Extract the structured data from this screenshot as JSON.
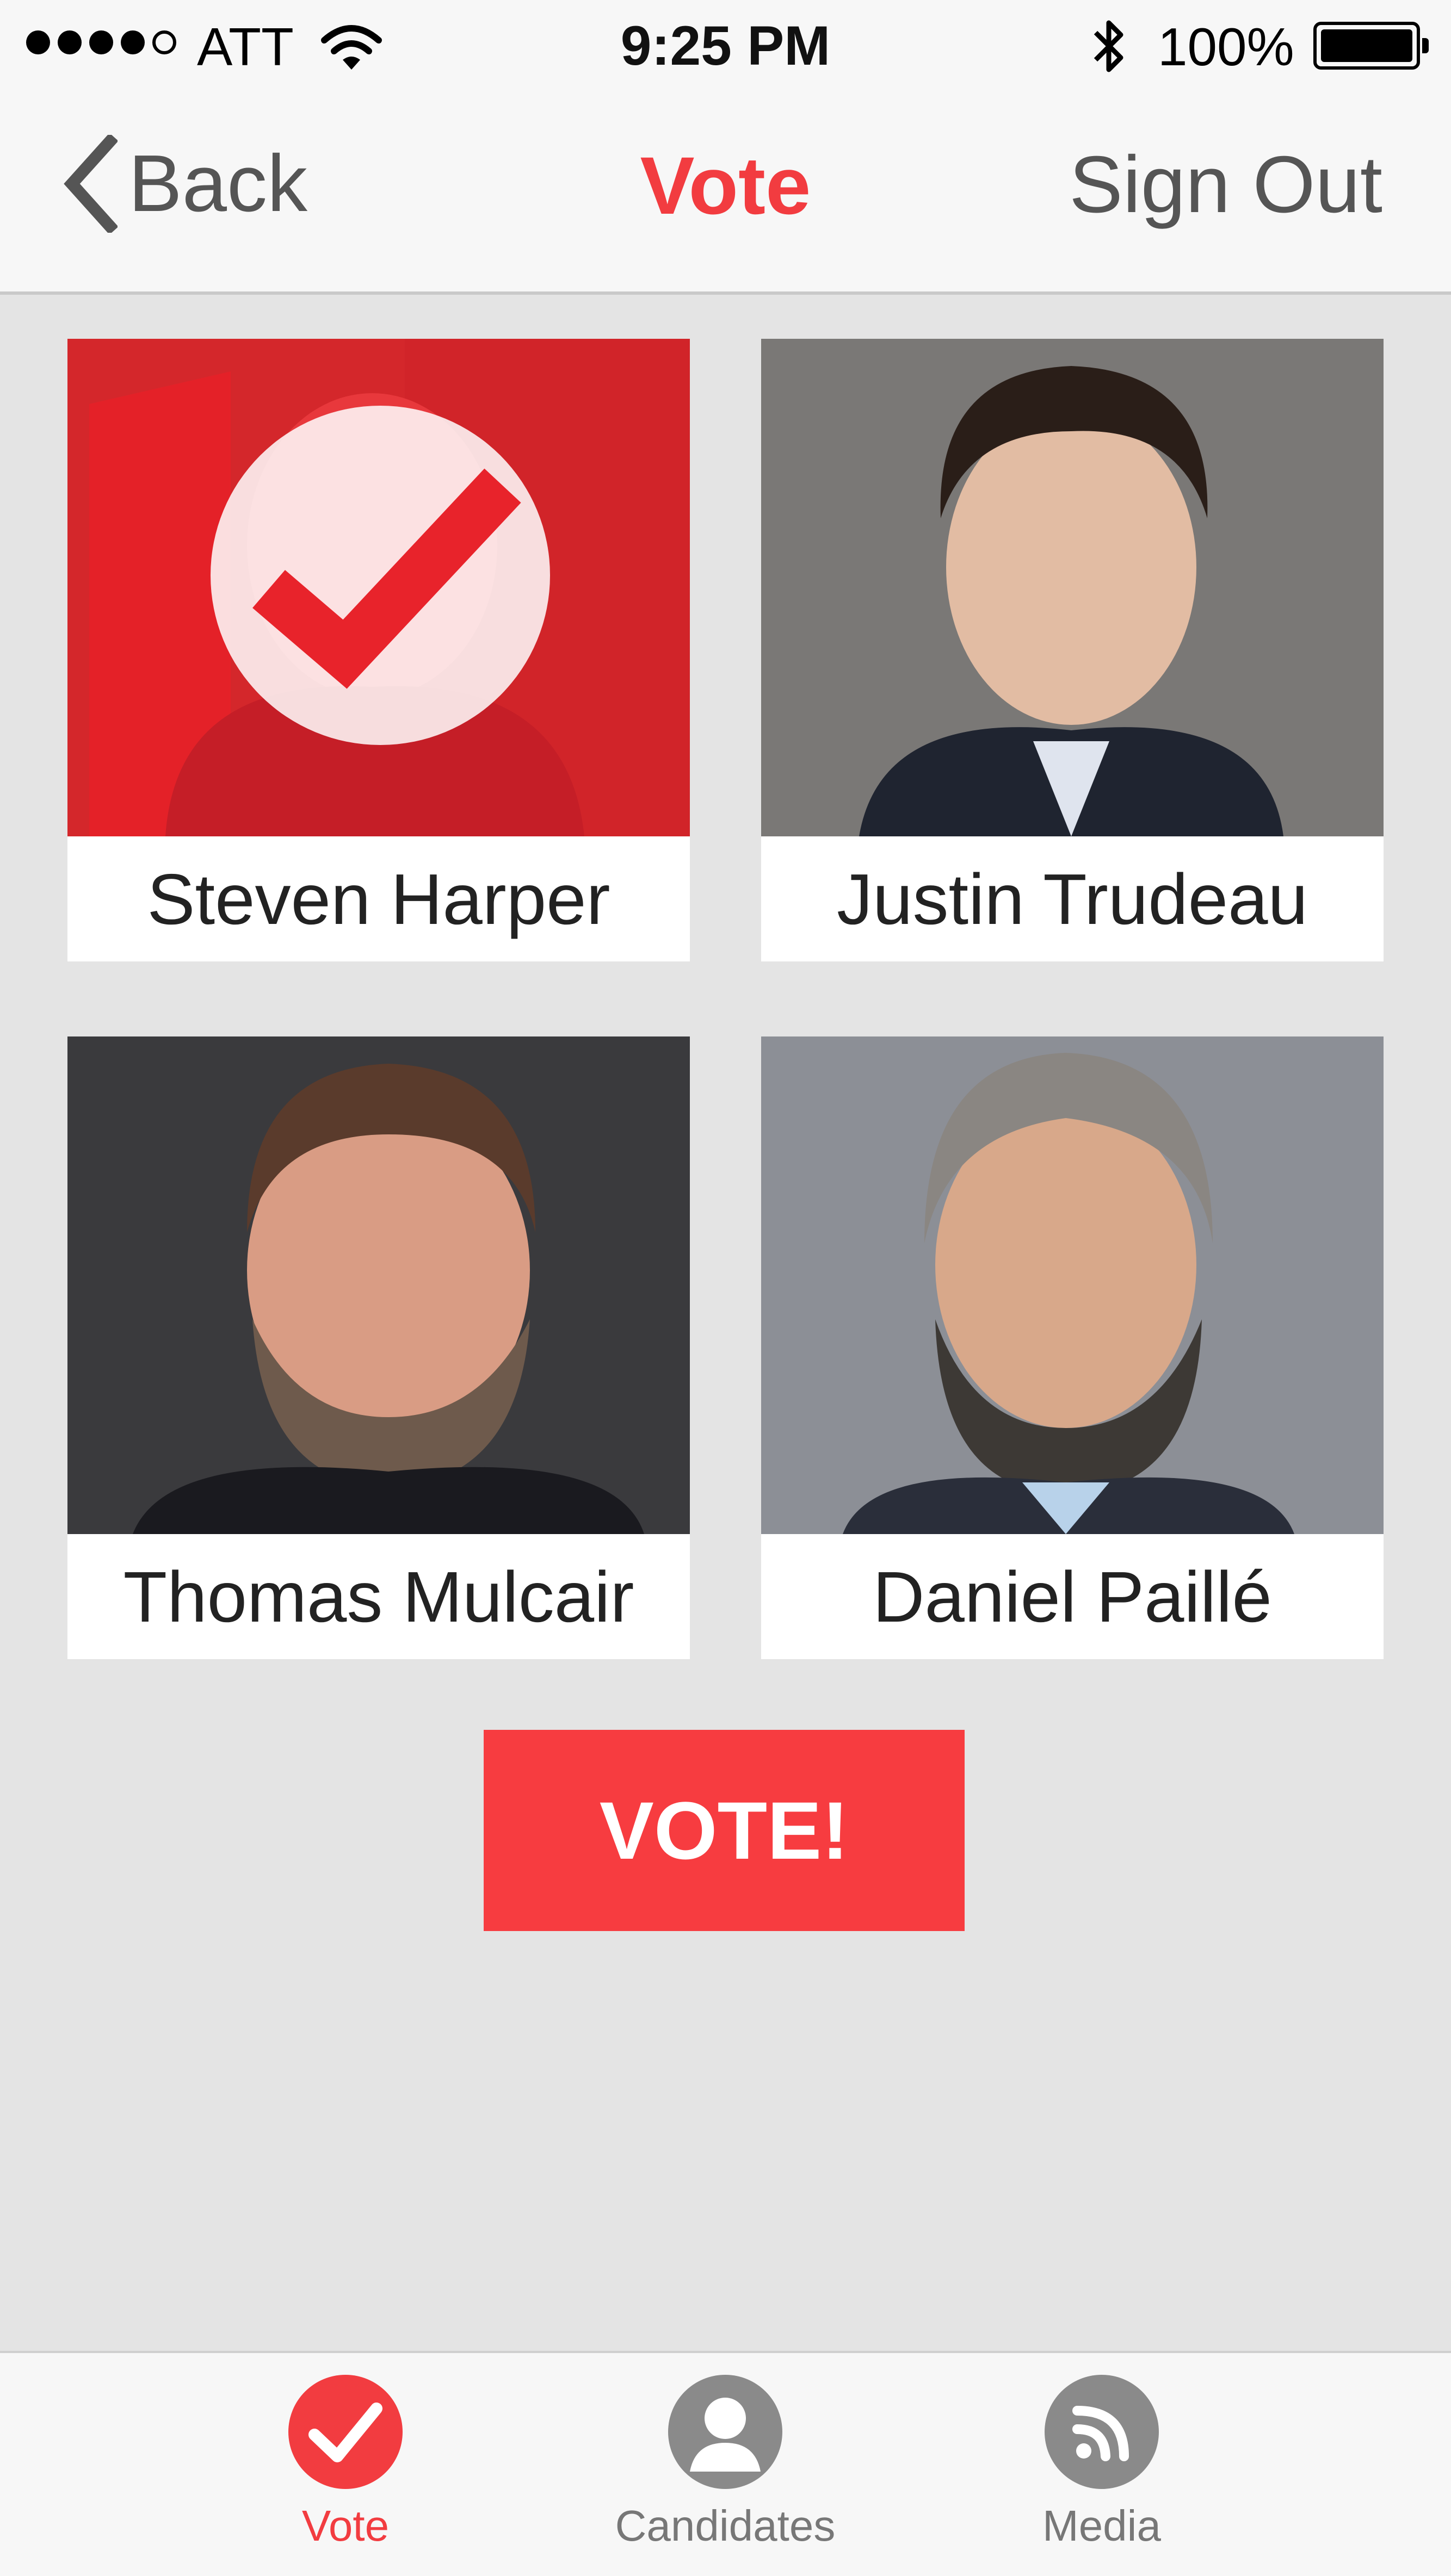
{
  "status_bar": {
    "carrier": "ATT",
    "time": "9:25 PM",
    "battery": "100%"
  },
  "nav": {
    "back_label": "Back",
    "title": "Vote",
    "sign_out_label": "Sign Out"
  },
  "candidates": [
    {
      "name": "Steven Harper",
      "selected": true
    },
    {
      "name": "Justin Trudeau",
      "selected": false
    },
    {
      "name": "Thomas Mulcair",
      "selected": false
    },
    {
      "name": "Daniel Paillé",
      "selected": false
    }
  ],
  "vote_button": {
    "label": "VOTE!"
  },
  "tabs": [
    {
      "label": "Vote",
      "icon": "checkmark-icon",
      "active": true
    },
    {
      "label": "Candidates",
      "icon": "person-icon",
      "active": false
    },
    {
      "label": "Media",
      "icon": "rss-icon",
      "active": false
    }
  ],
  "colors": {
    "accent": "#f23c40",
    "background": "#e4e4e4",
    "bar": "#f7f7f7"
  }
}
